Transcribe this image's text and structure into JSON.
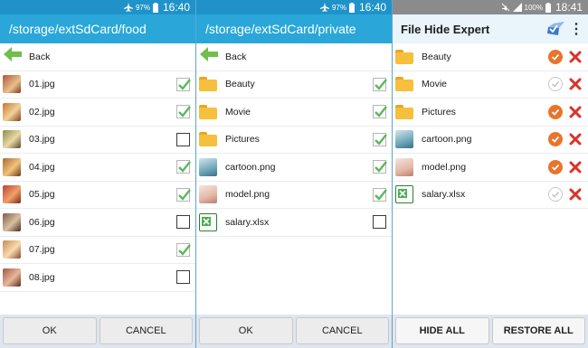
{
  "panels": [
    {
      "status": {
        "battery": "97%",
        "time": "16:40"
      },
      "title": "/storage/extSdCard/food",
      "back_label": "Back",
      "items": [
        {
          "name": "01.jpg",
          "checked": true,
          "color": "#b0563a"
        },
        {
          "name": "02.jpg",
          "checked": true,
          "color": "#c9752f"
        },
        {
          "name": "03.jpg",
          "checked": false,
          "color": "#8b8d4a"
        },
        {
          "name": "04.jpg",
          "checked": true,
          "color": "#a86b3b"
        },
        {
          "name": "05.jpg",
          "checked": true,
          "color": "#b8442f"
        },
        {
          "name": "06.jpg",
          "checked": false,
          "color": "#7f5a4a"
        },
        {
          "name": "07.jpg",
          "checked": true,
          "color": "#c98b55"
        },
        {
          "name": "08.jpg",
          "checked": false,
          "color": "#9b5a48"
        }
      ],
      "buttons": [
        "OK",
        "CANCEL"
      ]
    },
    {
      "status": {
        "battery": "97%",
        "time": "16:40"
      },
      "title": "/storage/extSdCard/private",
      "back_label": "Back",
      "items": [
        {
          "name": "Beauty",
          "type": "folder",
          "checked": true
        },
        {
          "name": "Movie",
          "type": "folder",
          "checked": true
        },
        {
          "name": "Pictures",
          "type": "folder",
          "checked": true
        },
        {
          "name": "cartoon.png",
          "type": "image",
          "checked": true,
          "color": "#6fa7b8"
        },
        {
          "name": "model.png",
          "type": "image",
          "checked": true,
          "color": "#e4b7a6"
        },
        {
          "name": "salary.xlsx",
          "type": "excel",
          "checked": false
        }
      ],
      "buttons": [
        "OK",
        "CANCEL"
      ]
    },
    {
      "status": {
        "battery": "100%",
        "time": "18:41"
      },
      "title": "File Hide Expert",
      "items": [
        {
          "name": "Beauty",
          "type": "folder",
          "hidden": true
        },
        {
          "name": "Movie",
          "type": "folder",
          "hidden": false
        },
        {
          "name": "Pictures",
          "type": "folder",
          "hidden": true
        },
        {
          "name": "cartoon.png",
          "type": "image",
          "hidden": true,
          "color": "#6fa7b8"
        },
        {
          "name": "model.png",
          "type": "image",
          "hidden": true,
          "color": "#e4b7a6"
        },
        {
          "name": "salary.xlsx",
          "type": "excel",
          "hidden": false
        }
      ],
      "buttons": [
        "HIDE ALL",
        "RESTORE ALL"
      ]
    }
  ],
  "colors": {
    "status_blue": "#1f93c9",
    "title_blue": "#2aa7d8",
    "hide_on": "#e8752c",
    "delete": "#d9342b",
    "check_green": "#5cb85c"
  }
}
